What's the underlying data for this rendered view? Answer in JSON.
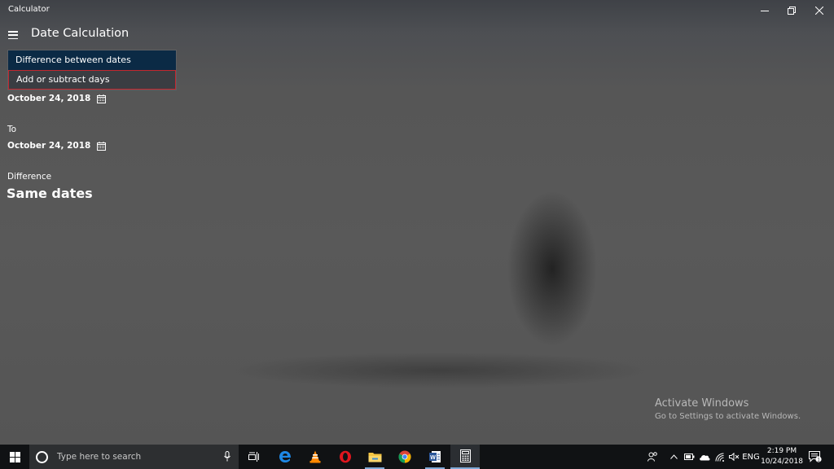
{
  "window": {
    "app_title": "Calculator",
    "minimize_icon": "minimize-icon",
    "maximize_icon": "restore-icon",
    "close_icon": "close-icon"
  },
  "header": {
    "menu_icon": "hamburger-menu-icon",
    "title": "Date Calculation"
  },
  "mode_dropdown": {
    "options": [
      {
        "label": "Difference between dates",
        "selected": true
      },
      {
        "label": "Add or subtract days",
        "selected": false,
        "hovered": true
      }
    ]
  },
  "from": {
    "date": "October 24, 2018",
    "icon": "calendar-icon"
  },
  "to": {
    "label": "To",
    "date": "October 24, 2018",
    "icon": "calendar-icon"
  },
  "difference": {
    "label": "Difference",
    "value": "Same dates"
  },
  "watermark": {
    "title": "Activate Windows",
    "subtitle": "Go to Settings to activate Windows."
  },
  "taskbar": {
    "search_placeholder": "Type here to search",
    "apps": [
      "task-view-icon",
      "edge-icon",
      "vlc-icon",
      "opera-icon",
      "file-explorer-icon",
      "chrome-icon",
      "word-icon",
      "calculator-icon"
    ],
    "tray": {
      "language": "ENG",
      "time": "2:19 PM",
      "date": "10/24/2018",
      "notification_count": "1"
    }
  },
  "colors": {
    "selected_option_bg": "#0b2a45",
    "hover_border": "#c4262e",
    "taskbar_bg": "#101214",
    "active_app_underline": "#7ea9d6"
  }
}
